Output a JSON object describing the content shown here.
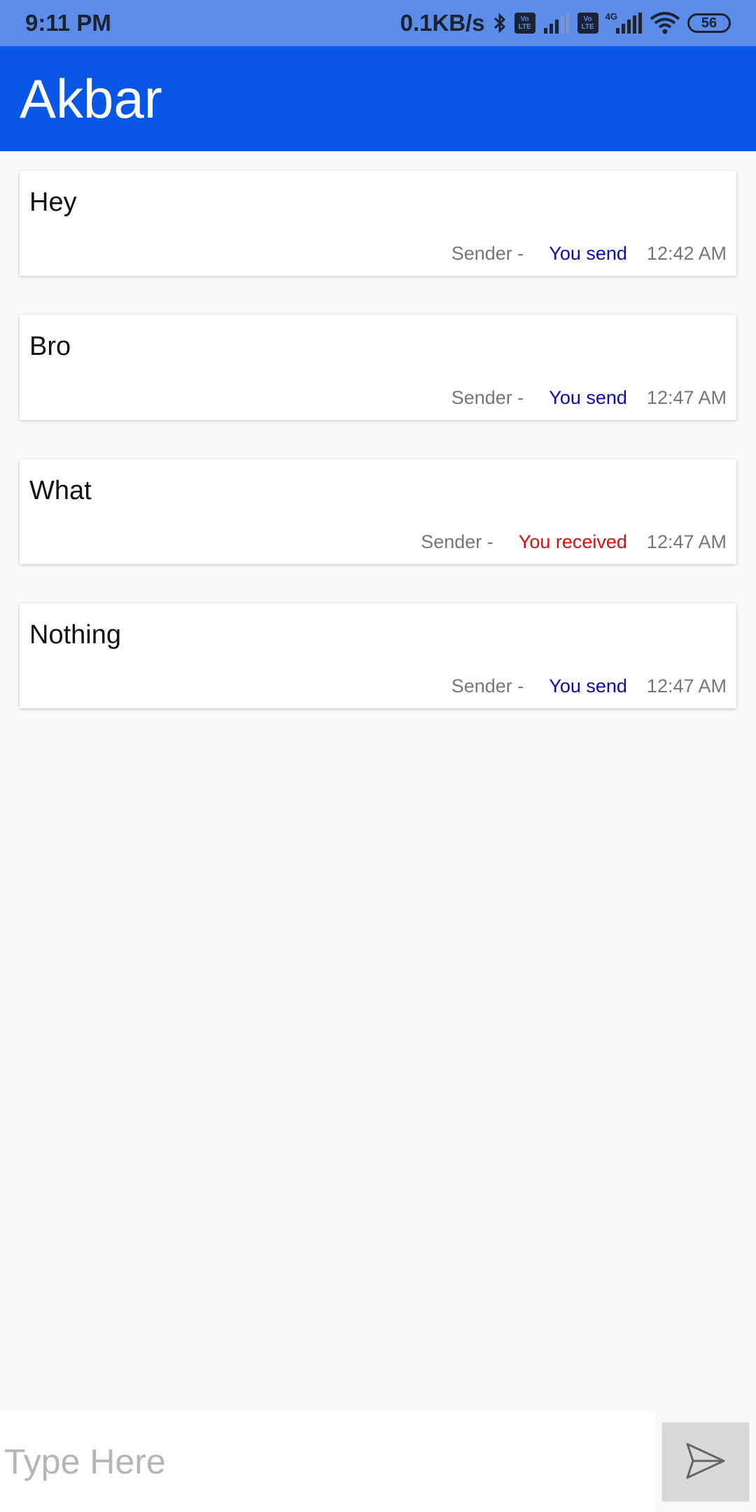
{
  "status_bar": {
    "time": "9:11 PM",
    "net_speed": "0.1KB/s",
    "volte_1": "Vo LTE",
    "volte_2": "Vo LTE",
    "network_type": "4G",
    "battery": "56",
    "icons": [
      "bluetooth-icon",
      "volte-icon",
      "signal-icon",
      "volte-icon",
      "signal-4g-icon",
      "wifi-icon",
      "battery-icon"
    ]
  },
  "header": {
    "title": "Akbar"
  },
  "messages": [
    {
      "text": "Hey",
      "sender_label": "Sender -",
      "direction": "You send",
      "time": "12:42 AM"
    },
    {
      "text": "Bro",
      "sender_label": "Sender -",
      "direction": "You send",
      "time": "12:47 AM"
    },
    {
      "text": "What",
      "sender_label": "Sender -",
      "direction": "You received",
      "time": "12:47 AM"
    },
    {
      "text": "Nothing",
      "sender_label": "Sender -",
      "direction": "You send",
      "time": "12:47 AM"
    }
  ],
  "composer": {
    "placeholder": "Type Here",
    "value": "",
    "send_icon": "send-icon"
  },
  "colors": {
    "status_bar": "#5b8ce8",
    "app_bar": "#0a57e6",
    "sent_label": "#0a0ab4",
    "received_label": "#d30f0f"
  }
}
